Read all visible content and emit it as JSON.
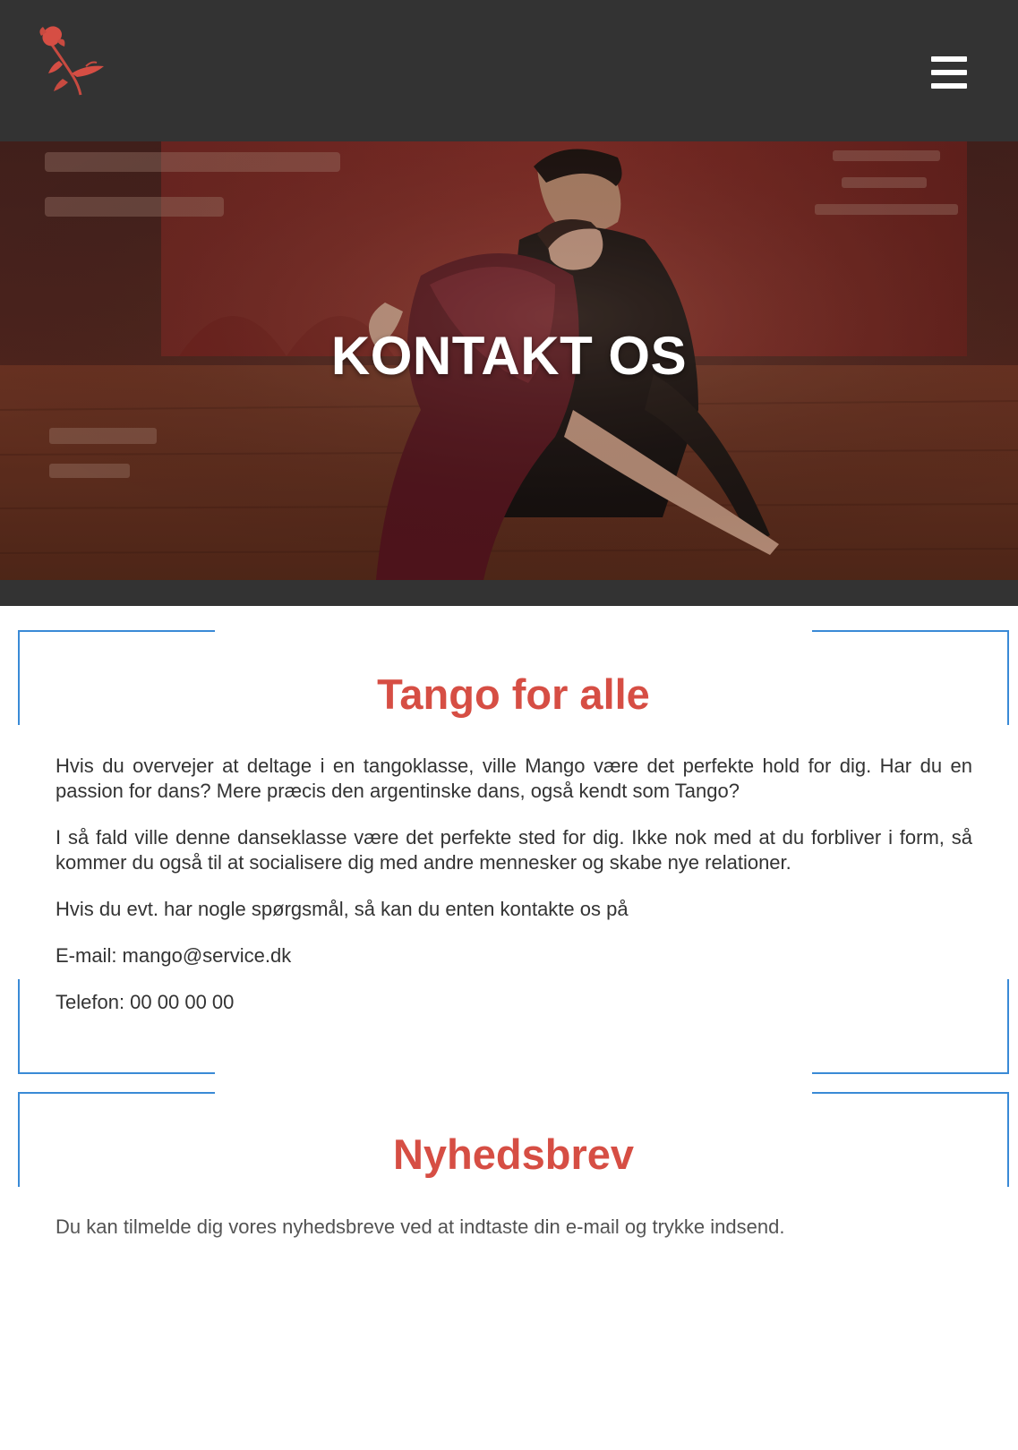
{
  "header": {
    "logo_icon": "rose-icon",
    "menu_icon": "hamburger-menu-icon"
  },
  "hero": {
    "title": "KONTAKT OS",
    "image": "tango-couple-photo"
  },
  "sections": [
    {
      "heading": "Tango for alle",
      "paragraphs": [
        "Hvis du overvejer at deltage i en tangoklasse, ville Mango være det perfekte hold for dig. Har du en passion for dans? Mere præcis den argentinske dans, også kendt som Tango?",
        "I så fald ville denne danseklasse være det perfekte sted for dig. Ikke nok med at du forbliver i form, så kommer du også til at socialisere dig med andre mennesker og skabe nye relationer.",
        "Hvis du evt. har nogle spørgsmål, så kan du enten kontakte os på",
        "E-mail: mango@service.dk",
        "Telefon: 00 00 00 00"
      ]
    },
    {
      "heading": "Nyhedsbrev",
      "paragraphs": [
        "Du kan tilmelde dig vores nyhedsbreve ved at indtaste din e-mail og trykke indsend."
      ]
    }
  ],
  "colors": {
    "header_bg": "#333333",
    "accent_red": "#d64e44",
    "frame_blue": "#3a8ad6",
    "body_text": "#333333"
  }
}
